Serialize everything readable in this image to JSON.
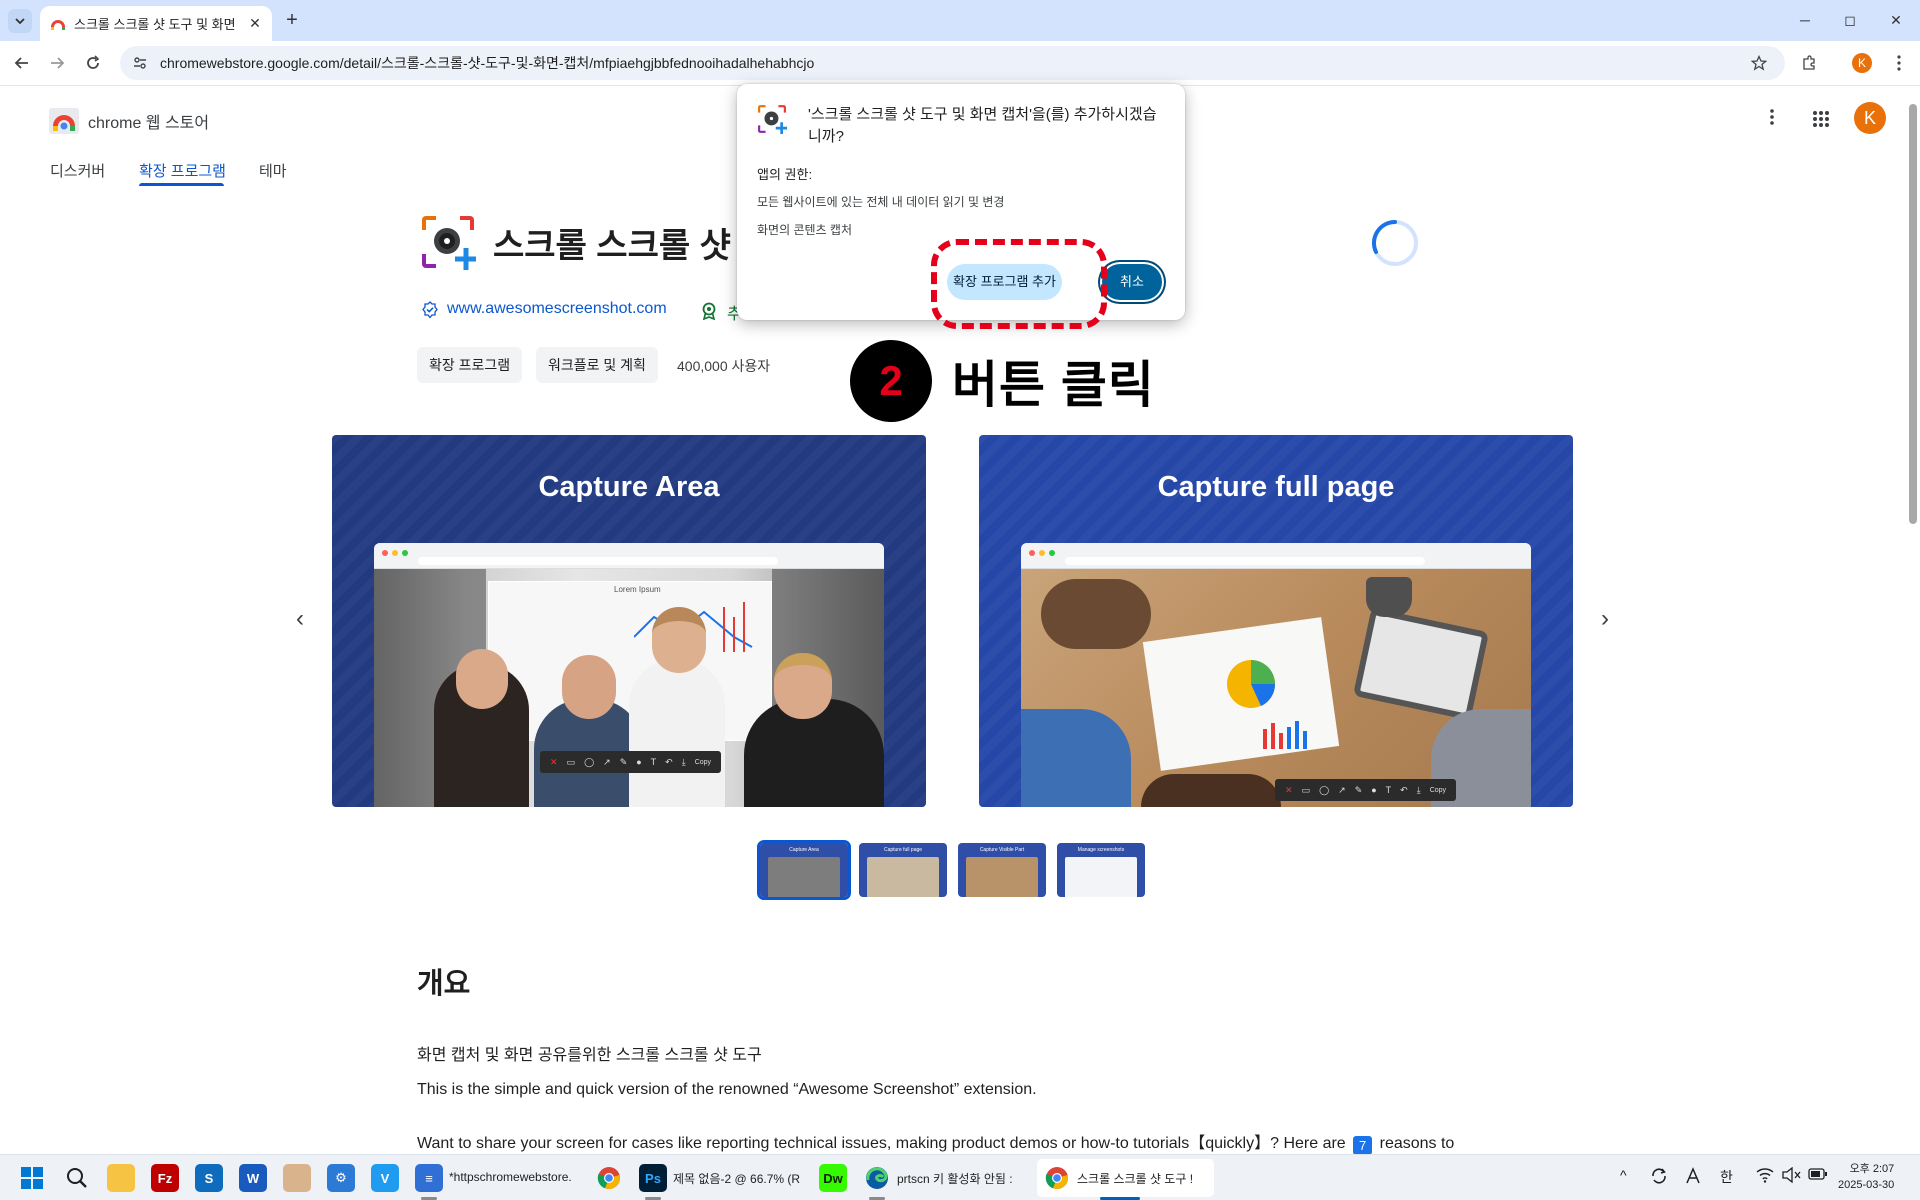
{
  "browser": {
    "tab_title": "스크롤 스크롤 샷 도구 및 화면",
    "tab_close": "✕",
    "new_tab": "+",
    "window_controls": [
      "─",
      "◻",
      "✕"
    ],
    "url": "chromewebstore.google.com/detail/스크롤-스크롤-샷-도구-및-화면-캡처/mfpiaehgjbbfednooihadalhehabhcjo",
    "profile_initial": "K",
    "icons": [
      "chevron-down-icon",
      "back-icon",
      "forward-icon",
      "reload-icon",
      "site-info-icon",
      "bookmark-star-icon",
      "extensions-icon",
      "menu-icon"
    ]
  },
  "store": {
    "name": "chrome 웹 스토어",
    "nav": [
      "디스커버",
      "확장 프로그램",
      "테마"
    ],
    "active_nav": "확장 프로그램",
    "profile_initial": "K"
  },
  "extension": {
    "title": "스크롤 스크롤 샷",
    "website": "www.awesomescreenshot.com",
    "featured_fragment": "추",
    "chips": [
      "확장 프로그램",
      "워크플로 및 계획"
    ],
    "users": "400,000 사용자"
  },
  "carousel": {
    "slides": [
      {
        "title": "Capture Area",
        "selection_label": "Lorem Ipsum"
      },
      {
        "title": "Capture full page"
      }
    ],
    "toolbar_tools": [
      "✕",
      "▭",
      "◯",
      "↗",
      "✎",
      "●",
      "T",
      "↶",
      "⤓",
      "Copy"
    ],
    "prev": "‹",
    "next": "›",
    "thumbnails": [
      "Capture Area",
      "Capture full page",
      "Capture Visible Part",
      "Manage screenshots"
    ],
    "selected_thumbnail": 0
  },
  "overview": {
    "heading": "개요",
    "line1": "화면 캡처 및 화면 공유를위한 스크롤 스크롤 샷 도구",
    "line2": "This is the simple and quick version of the renowned “Awesome Screenshot” extension.",
    "line3_start": "Want to share your screen for cases like reporting technical issues, making product demos or how-to tutorials【quickly】? Here are",
    "line3_num": "7",
    "line3_end": "reasons to"
  },
  "dialog": {
    "title": "'스크롤 스크롤 샷 도구 및 화면 캡처'을(를) 추가하시겠습니까?",
    "permissions_heading": "앱의 권한:",
    "permissions": [
      "모든 웹사이트에 있는 전체 내 데이터 읽기 및 변경",
      "화면의 콘텐츠 캡처"
    ],
    "add_button": "확장 프로그램 추가",
    "cancel_button": "취소"
  },
  "annotation": {
    "step_number": "2",
    "step_text": "버튼 클릭",
    "highlight_color": "#e4001b"
  },
  "taskbar": {
    "apps": [
      {
        "icon": "windows-start-icon"
      },
      {
        "icon": "search-icon"
      },
      {
        "icon": "file-explorer-icon"
      },
      {
        "icon": "filezilla-icon"
      },
      {
        "icon": "store-icon"
      },
      {
        "icon": "word-icon"
      },
      {
        "icon": "game-icon"
      },
      {
        "icon": "settings-app-icon"
      },
      {
        "icon": "vscode-icon"
      },
      {
        "icon": "notepad-icon",
        "label": "*httpschromewebstore."
      },
      {
        "icon": "chrome-icon"
      },
      {
        "icon": "photoshop-icon",
        "label": "제목 없음-2 @ 66.7% (R"
      },
      {
        "icon": "dreamweaver-icon"
      },
      {
        "icon": "edge-icon",
        "label": "prtscn 키 활성화 안됨 :"
      },
      {
        "icon": "chrome-icon",
        "label": "스크롤 스크롤 샷 도구 !"
      }
    ],
    "tray": [
      "^",
      "한"
    ],
    "time": "오후 2:07",
    "date": "2025-03-30"
  }
}
